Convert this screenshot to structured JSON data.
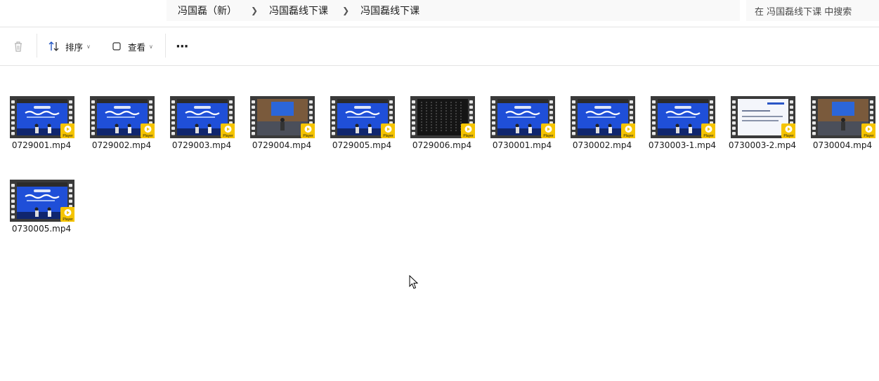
{
  "breadcrumb": {
    "items": [
      "冯国磊（新）",
      "冯国磊线下课",
      "冯国磊线下课"
    ]
  },
  "search": {
    "placeholder": "在 冯国磊线下课 中搜索"
  },
  "toolbar": {
    "sort_label": "排序",
    "view_label": "查看",
    "more_label": "···"
  },
  "files": [
    {
      "name": "0729001.mp4",
      "style": "stage"
    },
    {
      "name": "0729002.mp4",
      "style": "stage"
    },
    {
      "name": "0729003.mp4",
      "style": "stage"
    },
    {
      "name": "0729004.mp4",
      "style": "room"
    },
    {
      "name": "0729005.mp4",
      "style": "stage"
    },
    {
      "name": "0729006.mp4",
      "style": "dark"
    },
    {
      "name": "0730001.mp4",
      "style": "stage"
    },
    {
      "name": "0730002.mp4",
      "style": "stage"
    },
    {
      "name": "0730003-1.mp4",
      "style": "stage"
    },
    {
      "name": "0730003-2.mp4",
      "style": "doc"
    },
    {
      "name": "0730004.mp4",
      "style": "room"
    },
    {
      "name": "0730005.mp4",
      "style": "stage"
    }
  ],
  "badge_text": "Player",
  "colors": {
    "stage_blue": "#1f4fd8",
    "film_frame": "#3a3a3a",
    "badge_yellow": "#f5c400"
  }
}
